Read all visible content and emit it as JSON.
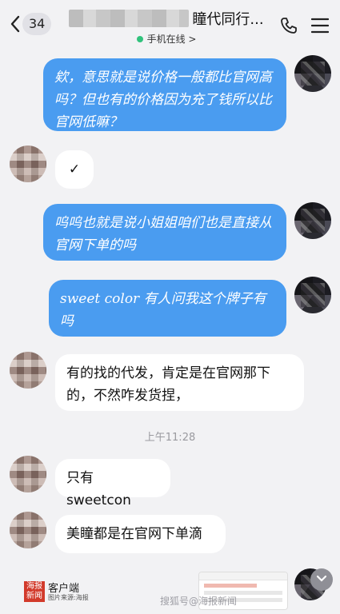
{
  "header": {
    "back_count": "34",
    "title": "瞳代同行...",
    "status": "手机在线 >"
  },
  "messages": [
    {
      "side": "right",
      "text": "欸，意思就是说价格一般都比官网高吗？但也有的价格因为充了钱所以比官网低嘛？"
    },
    {
      "side": "left",
      "text": "✓"
    },
    {
      "side": "right",
      "text": "呜呜也就是说小姐姐咱们也是直接从官网下单的吗"
    },
    {
      "side": "right",
      "text": "sweet color 有人问我这个牌子有吗"
    },
    {
      "side": "left",
      "text": "有的找的代发，肯定是在官网那下的，不然咋发货捏，"
    },
    {
      "side": "left",
      "text": "只有 sweetcon"
    },
    {
      "side": "left",
      "text": "美瞳都是在官网下单滴"
    }
  ],
  "timestamp": "上午11:28",
  "footer": {
    "logo_chars": "海报新闻",
    "logo_text": "客户端",
    "logo_sub": "图片来源:海报",
    "watermark": "搜狐号@海报新闻"
  },
  "icons": {
    "back": "chevron-left-icon",
    "call": "phone-icon",
    "menu": "hamburger-menu-icon",
    "scroll": "chevron-down-icon"
  },
  "colors": {
    "bubble_self": "#4a9cf0",
    "bubble_other": "#ffffff",
    "background": "#f2f2f4",
    "online": "#31c27c"
  }
}
